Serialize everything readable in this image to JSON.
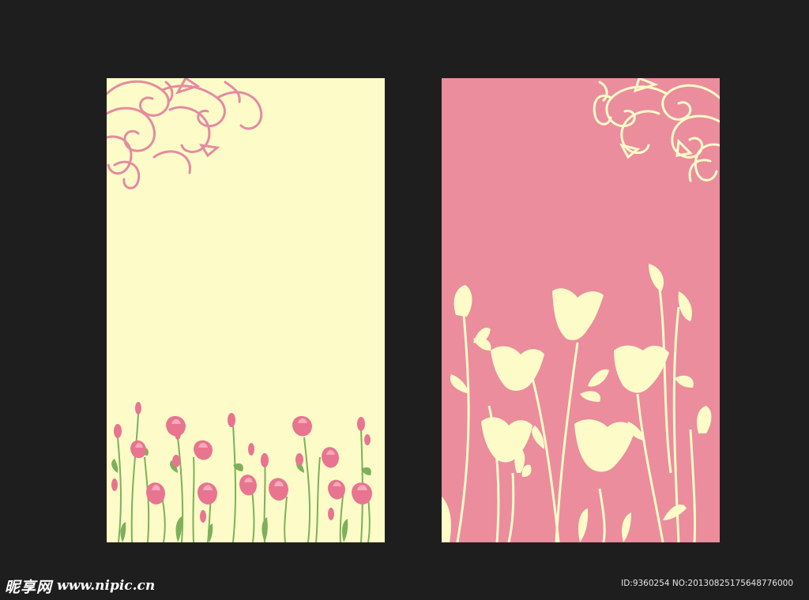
{
  "colors": {
    "background": "#1f1e1e",
    "left_card": "#fdfcc9",
    "right_card": "#eb8d9c",
    "swirl_left": "#e58aa0",
    "swirl_right": "#fdfcc9",
    "flower_pink": "#e9748f",
    "flower_light": "#f6aabb",
    "stem_green": "#7db05a",
    "silhouette": "#fdfcc9"
  },
  "icons": {
    "left_ornament": "swirl-ornament-icon",
    "right_ornament": "swirl-ornament-icon",
    "left_flowers": "rose-bud-icon",
    "right_flowers": "flower-silhouette-icon"
  },
  "watermark": {
    "brand_cn": "昵享网",
    "url": "www.nipic.cn",
    "id_text": "ID:9360254 NO:20130825175648776000"
  }
}
